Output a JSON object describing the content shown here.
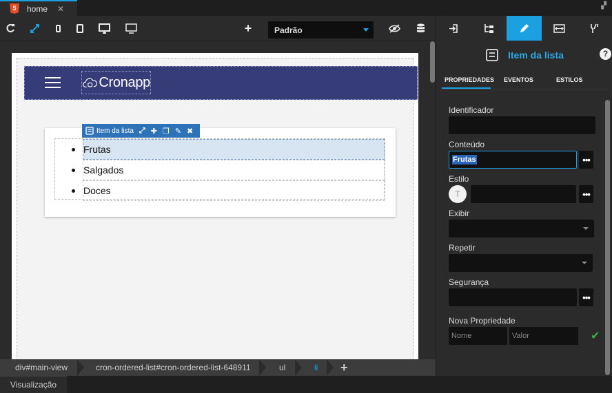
{
  "tabs": [
    {
      "label": "home",
      "close": "✕"
    }
  ],
  "toolbar": {
    "theme_select": "Padrão",
    "icons": [
      "refresh-icon",
      "fullscreen-icon",
      "phone-icon",
      "tablet-icon",
      "desktop-icon",
      "monitor-icon",
      "add-icon",
      "eye-off-icon",
      "database-icon"
    ]
  },
  "canvas": {
    "brand": "Cronapp",
    "selection_toolbar_label": "Item da lista",
    "list_items": [
      "Frutas",
      "Salgados",
      "Doces"
    ]
  },
  "breadcrumb": [
    {
      "label": "div#main-view",
      "active": false
    },
    {
      "label": "cron-ordered-list#cron-ordered-list-648911",
      "active": false
    },
    {
      "label": "ul",
      "active": false
    },
    {
      "label": "li",
      "active": true
    }
  ],
  "bottom": {
    "tab": "Visualização"
  },
  "panel": {
    "title": "Item da lista",
    "subtabs": [
      "PROPRIEDADES",
      "EVENTOS",
      "ESTILOS"
    ],
    "fields": {
      "identificador": {
        "label": "Identificador",
        "value": ""
      },
      "conteudo": {
        "label": "Conteúdo",
        "value": "Frutas"
      },
      "estilo": {
        "label": "Estilo",
        "value": "",
        "circle": "T"
      },
      "exibir": {
        "label": "Exibir",
        "value": ""
      },
      "repetir": {
        "label": "Repetir",
        "value": ""
      },
      "seguranca": {
        "label": "Segurança",
        "value": ""
      }
    },
    "nova_propriedade": {
      "label": "Nova Propriedade",
      "name_placeholder": "Nome",
      "value_placeholder": "Valor"
    },
    "more_button": "•••",
    "help": "?"
  },
  "colors": {
    "accent": "#1ba1e2",
    "navbar": "#363c77",
    "selection": "#2e72b8"
  }
}
